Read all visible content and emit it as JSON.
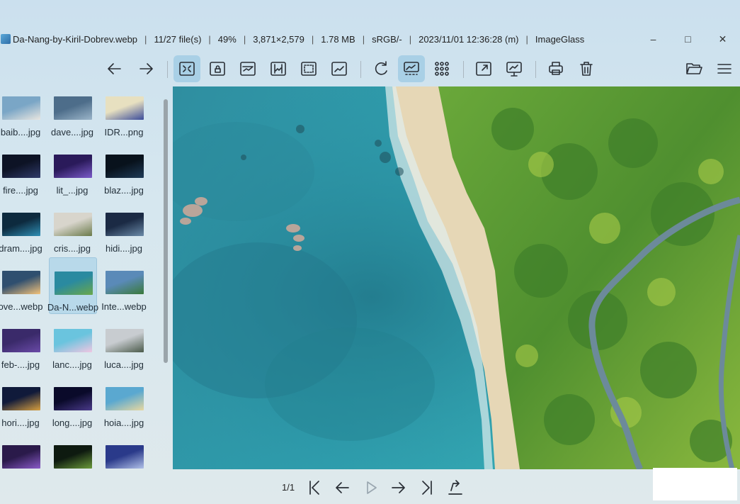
{
  "window": {
    "filename": "Da-Nang-by-Kiril-Dobrev.webp",
    "file_index": "11/27 file(s)",
    "zoom": "49%",
    "dimensions": "3,871×2,579",
    "filesize": "1.78 MB",
    "color_profile": "sRGB/-",
    "datetime": "2023/11/01 12:36:28 (m)",
    "app_name": "ImageGlass",
    "separator": "|",
    "minimize": "–",
    "maximize": "□",
    "close": "✕"
  },
  "toolbar": {
    "items": [
      "back-arrow-icon",
      "forward-arrow-icon",
      "zoom-fit-icon",
      "zoom-lock-icon",
      "scale-to-width-icon",
      "scale-to-height-icon",
      "scale-to-fill-icon",
      "auto-zoom-icon",
      "refresh-icon",
      "gallery-icon",
      "grid-icon",
      "fullscreen-icon",
      "slideshow-icon",
      "print-icon",
      "delete-icon",
      "open-folder-icon",
      "menu-icon"
    ],
    "active": [
      "zoom-fit-icon",
      "gallery-icon"
    ]
  },
  "thumbnails": [
    {
      "label": "baib....jpg",
      "colors": [
        "#7aa6c6",
        "#e9e6e0"
      ]
    },
    {
      "label": "dave....jpg",
      "colors": [
        "#4d6d8a",
        "#9bb5c9"
      ]
    },
    {
      "label": "IDR...png",
      "colors": [
        "#e7e0c0",
        "#3b4b9a"
      ]
    },
    {
      "label": "fire....jpg",
      "colors": [
        "#0d1325",
        "#2f3a6a"
      ]
    },
    {
      "label": "lit_...jpg",
      "colors": [
        "#2a1a5a",
        "#7a5ac9"
      ]
    },
    {
      "label": "blaz....jpg",
      "colors": [
        "#08121c",
        "#1f3b58"
      ]
    },
    {
      "label": "dram....jpg",
      "colors": [
        "#0d2a3e",
        "#2f8fb5"
      ]
    },
    {
      "label": "cris....jpg",
      "colors": [
        "#d8d5cc",
        "#6a7a4a"
      ]
    },
    {
      "label": "hidi....jpg",
      "colors": [
        "#1b2a44",
        "#6a8aa8"
      ]
    },
    {
      "label": "ove...webp",
      "colors": [
        "#2f4f6f",
        "#f3c27a"
      ]
    },
    {
      "label": "Da-N...webp",
      "colors": [
        "#2a8aa0",
        "#6aa84a"
      ]
    },
    {
      "label": "Inte...webp",
      "colors": [
        "#5a8ab8",
        "#3a7a3a"
      ]
    },
    {
      "label": "feb-....jpg",
      "colors": [
        "#3a2a6a",
        "#6a4aa8"
      ]
    },
    {
      "label": "lanc....jpg",
      "colors": [
        "#6ac4de",
        "#f0c6e2"
      ]
    },
    {
      "label": "luca....jpg",
      "colors": [
        "#c8ccd0",
        "#4a5a4a"
      ]
    },
    {
      "label": "hori....jpg",
      "colors": [
        "#101a3a",
        "#d8a040"
      ]
    },
    {
      "label": "long....jpg",
      "colors": [
        "#0a0a2a",
        "#4a3a8a"
      ]
    },
    {
      "label": "hoia....jpg",
      "colors": [
        "#5aa8d0",
        "#e8d8a0"
      ]
    },
    {
      "label": "",
      "colors": [
        "#2a1a4a",
        "#8a5ac8"
      ]
    },
    {
      "label": "",
      "colors": [
        "#0e1a10",
        "#6a9a3a"
      ]
    },
    {
      "label": "",
      "colors": [
        "#2a3a8a",
        "#b0c0e8"
      ]
    }
  ],
  "selected_index": 10,
  "nav": {
    "count": "1/1",
    "buttons": [
      "first-icon",
      "prev-icon",
      "play-icon",
      "next-icon",
      "last-icon",
      "export-icon"
    ],
    "disabled": [
      "play-icon"
    ]
  }
}
